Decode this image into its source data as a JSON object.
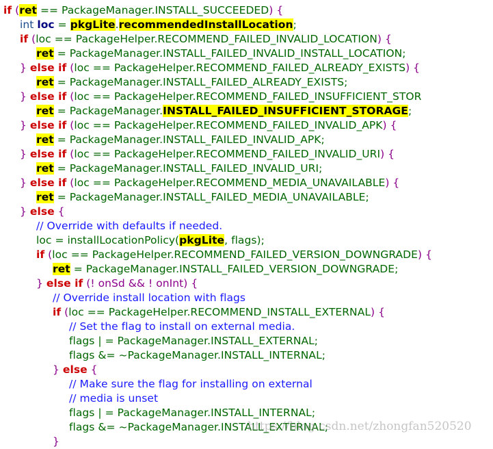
{
  "editor": {
    "lines": [
      {
        "indent": 0,
        "tokens": [
          [
            "kw",
            "if"
          ],
          [
            "pu",
            " ("
          ],
          [
            "hl",
            "ret"
          ],
          [
            "pl",
            " == PackageManager.INSTALL_SUCCEEDED"
          ],
          [
            "pu",
            ") {"
          ]
        ]
      },
      {
        "indent": 1,
        "tokens": [
          [
            "ty",
            "int "
          ],
          [
            "bo",
            "loc"
          ],
          [
            "pl",
            " = "
          ],
          [
            "hl",
            "pkgLite"
          ],
          [
            "pl",
            "."
          ],
          [
            "hl",
            "recommendedInstallLocation"
          ],
          [
            "pl",
            ";"
          ]
        ]
      },
      {
        "indent": 1,
        "tokens": [
          [
            "kw",
            "if"
          ],
          [
            "pu",
            " ("
          ],
          [
            "pl",
            "loc == PackageHelper.RECOMMEND_FAILED_INVALID_LOCATION"
          ],
          [
            "pu",
            ") {"
          ]
        ]
      },
      {
        "indent": 2,
        "tokens": [
          [
            "hl",
            "ret"
          ],
          [
            "pl",
            " = PackageManager.INSTALL_FAILED_INVALID_INSTALL_LOCATION;"
          ]
        ]
      },
      {
        "indent": 1,
        "tokens": [
          [
            "pu",
            "} "
          ],
          [
            "kw",
            "else if"
          ],
          [
            "pu",
            " ("
          ],
          [
            "pl",
            "loc == PackageHelper.RECOMMEND_FAILED_ALREADY_EXISTS"
          ],
          [
            "pu",
            ") {"
          ]
        ]
      },
      {
        "indent": 2,
        "tokens": [
          [
            "hl",
            "ret"
          ],
          [
            "pl",
            " = PackageManager.INSTALL_FAILED_ALREADY_EXISTS;"
          ]
        ]
      },
      {
        "indent": 1,
        "tokens": [
          [
            "pu",
            "} "
          ],
          [
            "kw",
            "else if"
          ],
          [
            "pu",
            " ("
          ],
          [
            "pl",
            "loc == PackageHelper.RECOMMEND_FAILED_INSUFFICIENT_STOR"
          ]
        ]
      },
      {
        "indent": 2,
        "tokens": [
          [
            "hl",
            "ret"
          ],
          [
            "pl",
            " = PackageManager."
          ],
          [
            "hl",
            "INSTALL_FAILED_INSUFFICIENT_STORAGE"
          ],
          [
            "pl",
            ";"
          ]
        ]
      },
      {
        "indent": 1,
        "tokens": [
          [
            "pu",
            "} "
          ],
          [
            "kw",
            "else if"
          ],
          [
            "pu",
            " ("
          ],
          [
            "pl",
            "loc == PackageHelper.RECOMMEND_FAILED_INVALID_APK"
          ],
          [
            "pu",
            ") {"
          ]
        ]
      },
      {
        "indent": 2,
        "tokens": [
          [
            "hl",
            "ret"
          ],
          [
            "pl",
            " = PackageManager.INSTALL_FAILED_INVALID_APK;"
          ]
        ]
      },
      {
        "indent": 1,
        "tokens": [
          [
            "pu",
            "} "
          ],
          [
            "kw",
            "else if"
          ],
          [
            "pu",
            " ("
          ],
          [
            "pl",
            "loc == PackageHelper.RECOMMEND_FAILED_INVALID_URI"
          ],
          [
            "pu",
            ") {"
          ]
        ]
      },
      {
        "indent": 2,
        "tokens": [
          [
            "hl",
            "ret"
          ],
          [
            "pl",
            " = PackageManager.INSTALL_FAILED_INVALID_URI;"
          ]
        ]
      },
      {
        "indent": 1,
        "tokens": [
          [
            "pu",
            "} "
          ],
          [
            "kw",
            "else if"
          ],
          [
            "pu",
            " ("
          ],
          [
            "pl",
            "loc == PackageHelper.RECOMMEND_MEDIA_UNAVAILABLE"
          ],
          [
            "pu",
            ") {"
          ]
        ]
      },
      {
        "indent": 2,
        "tokens": [
          [
            "hl",
            "ret"
          ],
          [
            "pl",
            " = PackageManager.INSTALL_FAILED_MEDIA_UNAVAILABLE;"
          ]
        ]
      },
      {
        "indent": 1,
        "tokens": [
          [
            "pu",
            "} "
          ],
          [
            "kw",
            "else"
          ],
          [
            "pu",
            " {"
          ]
        ]
      },
      {
        "indent": 2,
        "tokens": [
          [
            "cm",
            "// Override with defaults if needed."
          ]
        ]
      },
      {
        "indent": 2,
        "tokens": [
          [
            "pl",
            "loc = installLocationPolicy("
          ],
          [
            "hl",
            "pkgLite"
          ],
          [
            "pl",
            ", flags);"
          ]
        ]
      },
      {
        "indent": 2,
        "tokens": [
          [
            "kw",
            "if"
          ],
          [
            "pu",
            " ("
          ],
          [
            "pl",
            "loc == PackageHelper.RECOMMEND_FAILED_VERSION_DOWNGRADE"
          ],
          [
            "pu",
            ") {"
          ]
        ]
      },
      {
        "indent": 3,
        "tokens": [
          [
            "hl",
            "ret"
          ],
          [
            "pl",
            " = PackageManager.INSTALL_FAILED_VERSION_DOWNGRADE;"
          ]
        ]
      },
      {
        "indent": 2,
        "tokens": [
          [
            "pu",
            "} "
          ],
          [
            "kw",
            "else if"
          ],
          [
            "pu",
            " (! onSd && ! onInt) {"
          ]
        ]
      },
      {
        "indent": 3,
        "tokens": [
          [
            "cm",
            "// Override install location with flags"
          ]
        ]
      },
      {
        "indent": 3,
        "tokens": [
          [
            "kw",
            "if"
          ],
          [
            "pu",
            " ("
          ],
          [
            "pl",
            "loc == PackageHelper.RECOMMEND_INSTALL_EXTERNAL"
          ],
          [
            "pu",
            ") {"
          ]
        ]
      },
      {
        "indent": 4,
        "tokens": [
          [
            "cm",
            "// Set the flag to install on external media."
          ]
        ]
      },
      {
        "indent": 4,
        "tokens": [
          [
            "pl",
            "flags | = PackageManager.INSTALL_EXTERNAL;"
          ]
        ]
      },
      {
        "indent": 4,
        "tokens": [
          [
            "pl",
            "flags &= ~PackageManager.INSTALL_INTERNAL;"
          ]
        ]
      },
      {
        "indent": 3,
        "tokens": [
          [
            "pu",
            "} "
          ],
          [
            "kw",
            "else"
          ],
          [
            "pu",
            " {"
          ]
        ]
      },
      {
        "indent": 4,
        "tokens": [
          [
            "cm",
            "// Make sure the flag for installing on external"
          ]
        ]
      },
      {
        "indent": 4,
        "tokens": [
          [
            "cm",
            "// media is unset"
          ]
        ]
      },
      {
        "indent": 4,
        "tokens": [
          [
            "pl",
            "flags | = PackageManager.INSTALL_INTERNAL;"
          ]
        ]
      },
      {
        "indent": 4,
        "tokens": [
          [
            "pl",
            "flags &= ~PackageManager.INSTALL_EXTERNAL;"
          ]
        ]
      },
      {
        "indent": 3,
        "tokens": [
          [
            "pu",
            "}"
          ]
        ]
      }
    ]
  },
  "watermark": "https://blog.csdn.net/zhongfan520520",
  "colors": {
    "keyword": "#cc0000",
    "plain": "#006600",
    "comment": "#1a1aff",
    "punct": "#8b008b",
    "highlight": "#ffff00"
  }
}
